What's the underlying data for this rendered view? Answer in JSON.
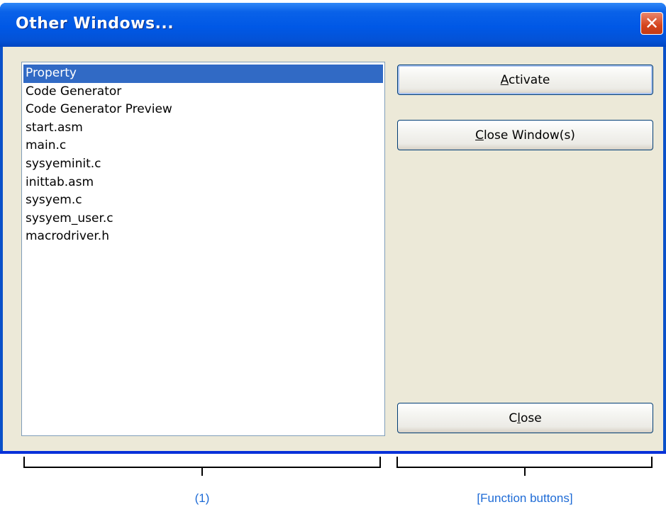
{
  "window": {
    "title": "Other Windows...",
    "close_glyph": "✕"
  },
  "window_list": {
    "items": [
      "Property",
      "Code Generator",
      "Code Generator Preview",
      "start.asm",
      "main.c",
      "sysyeminit.c",
      "inittab.asm",
      "sysyem.c",
      "sysyem_user.c",
      "macrodriver.h"
    ],
    "selected": "Property"
  },
  "buttons": {
    "activate": {
      "mnemonic": "A",
      "rest": "ctivate"
    },
    "close_windows": {
      "mnemonic": "C",
      "rest": "lose Window(s)"
    },
    "close": {
      "pre": "C",
      "mnemonic": "l",
      "rest": "ose"
    }
  },
  "callouts": {
    "list_label": "(1)",
    "buttons_label": "[Function buttons]"
  },
  "colors": {
    "title_bar": "#0058e6",
    "selection": "#316ac5",
    "dialog_face": "#ece9d8",
    "callout_text": "#1e6bd6"
  }
}
